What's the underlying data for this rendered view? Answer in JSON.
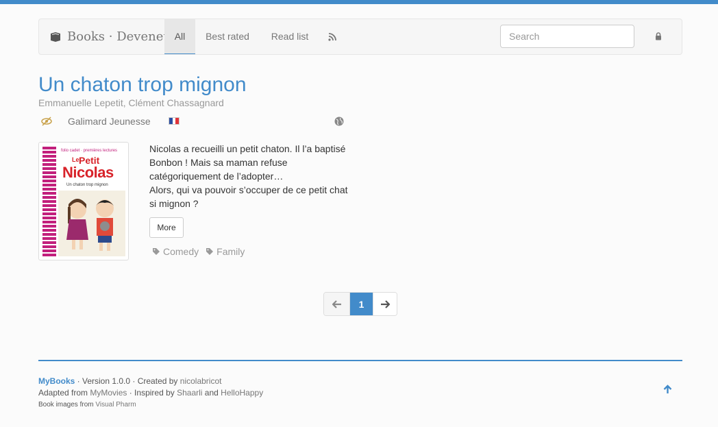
{
  "nav": {
    "brand": "Books · Devenet",
    "items": [
      {
        "label": "All",
        "active": true
      },
      {
        "label": "Best rated"
      },
      {
        "label": "Read list"
      }
    ],
    "rss_icon": "rss-icon",
    "search_placeholder": "Search",
    "lock_icon": "lock-icon"
  },
  "book": {
    "title": "Un chaton trop mignon",
    "authors": "Emmanuelle Lepetit, Clément Chassagnard",
    "publisher": "Galimard Jeunesse",
    "language_flag": "fr-flag-icon",
    "description": [
      "Nicolas a recueilli un petit chaton. Il l’a baptisé Bonbon ! Mais sa maman refuse catégoriquement de l’adopter…",
      "Alors, qui va pouvoir s’occuper de ce petit chat si mignon ?"
    ],
    "more_label": "More",
    "tags": [
      "Comedy",
      "Family"
    ],
    "cover": {
      "top_text": "folio cadet · premières lectures",
      "le": "Le",
      "petit": "Petit",
      "nicolas": "Nicolas",
      "subtitle": "Un chaton trop mignon"
    }
  },
  "pagination": {
    "current": "1"
  },
  "footer": {
    "brand": "MyBooks",
    "version": " · Version 1.0.0 · Created by ",
    "author": "nicolabricot",
    "adapted": "Adapted from ",
    "mymovies": "MyMovies",
    "inspired": " · Inspired by ",
    "shaarli": "Shaarli",
    "and": " and ",
    "hellohappy": "HelloHappy",
    "images": "Book images from ",
    "visualpharm": "Visual Pharm"
  },
  "colors": {
    "accent": "#428bca",
    "tag": "#999999",
    "cover_accent": "#c21f7c"
  }
}
